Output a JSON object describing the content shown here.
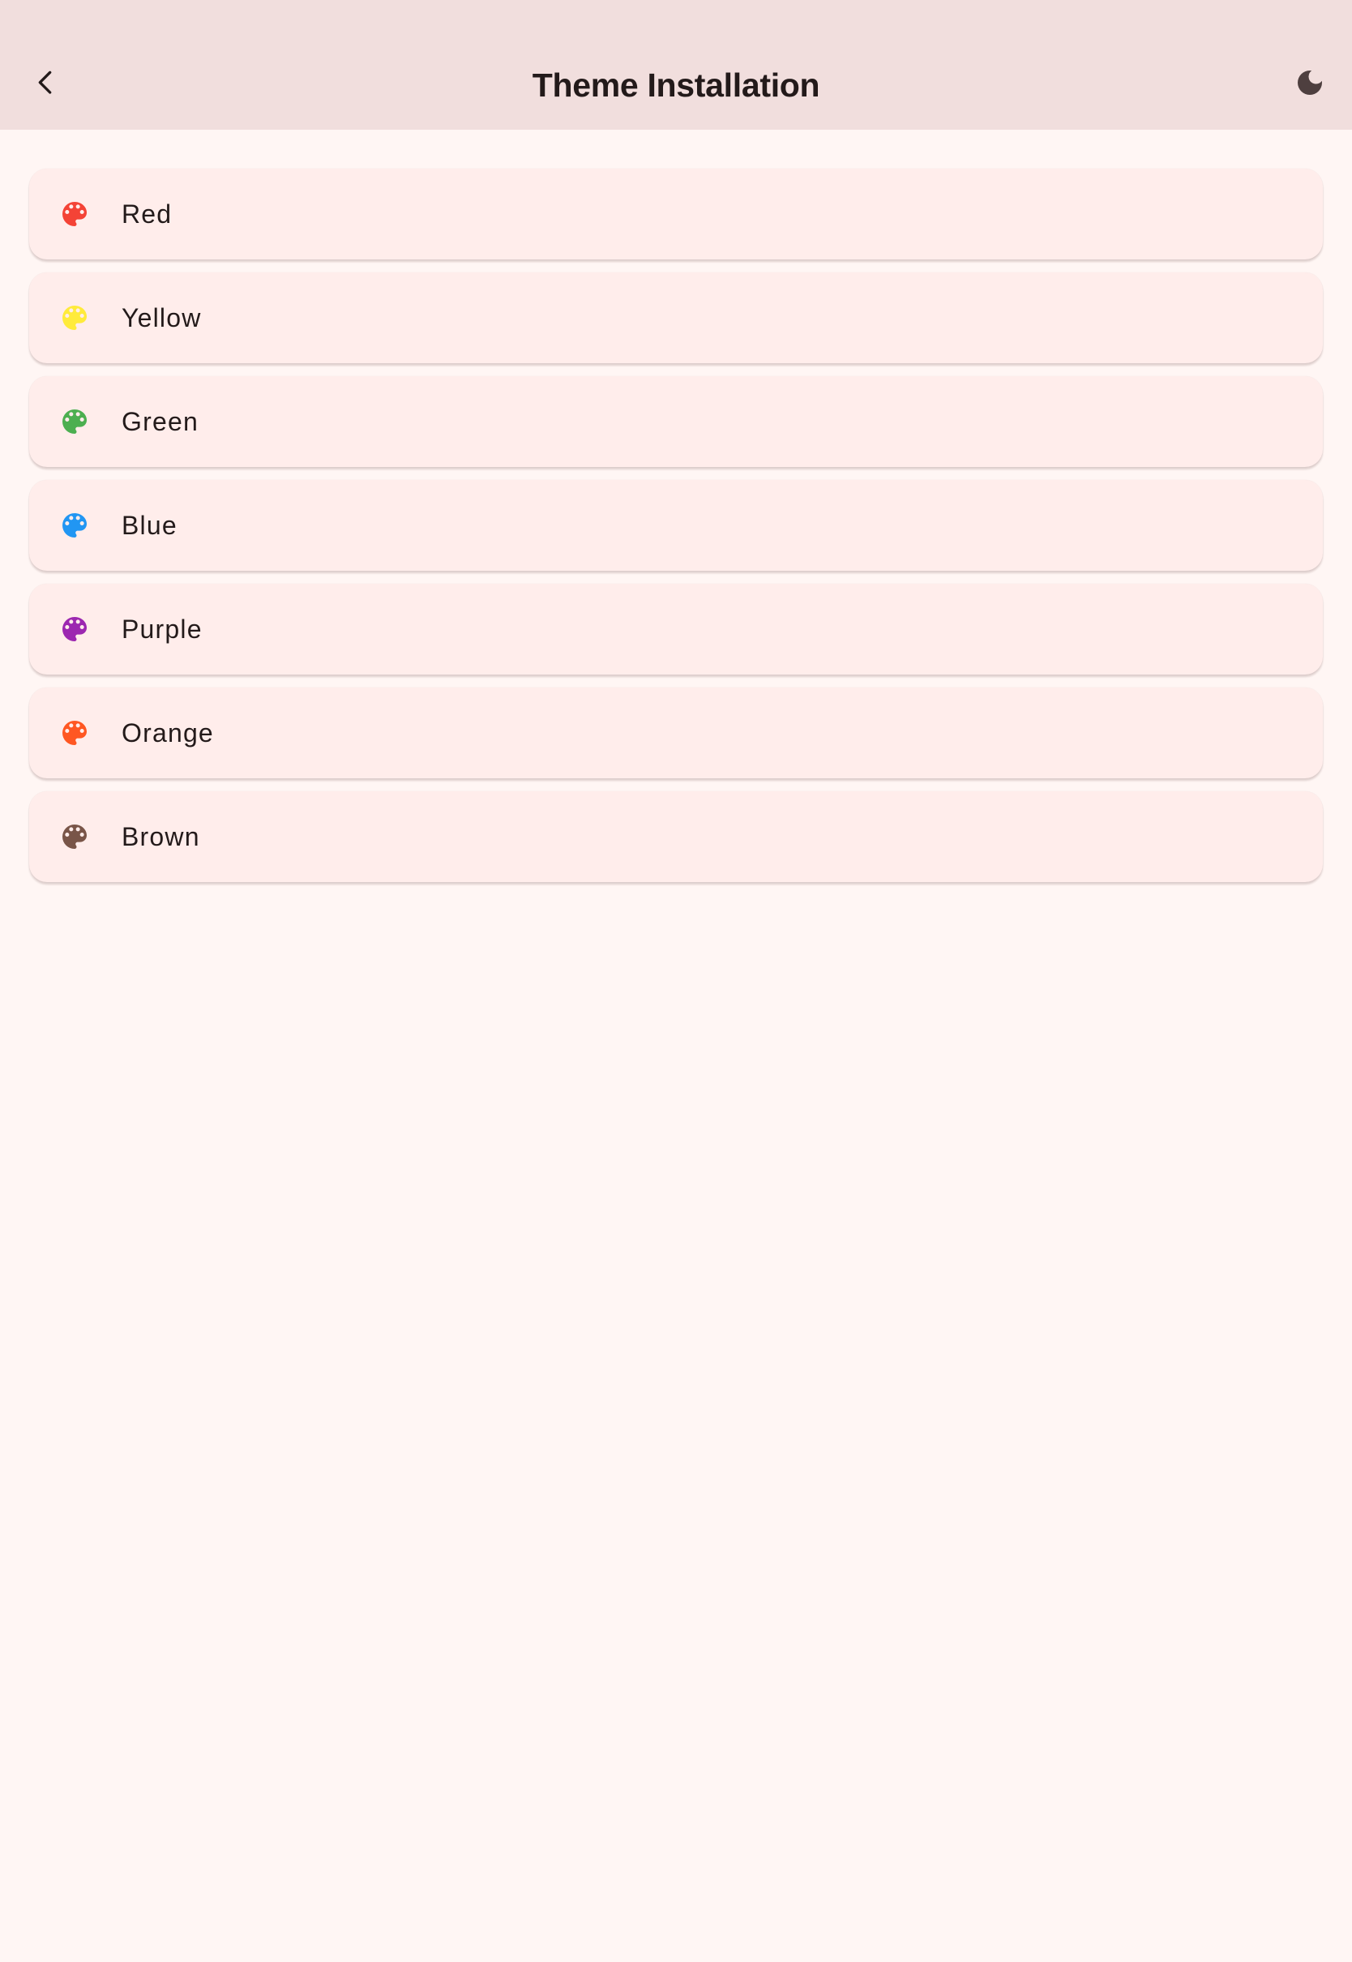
{
  "app_bar": {
    "title": "Theme Installation",
    "back_icon": "chevron-left-icon",
    "toggle_icon": "moon-icon",
    "background": "#F1DEDD"
  },
  "themes": [
    {
      "label": "Red",
      "icon": "palette-icon",
      "color": "#F44336"
    },
    {
      "label": "Yellow",
      "icon": "palette-icon",
      "color": "#FFEB3B"
    },
    {
      "label": "Green",
      "icon": "palette-icon",
      "color": "#4CAF50"
    },
    {
      "label": "Blue",
      "icon": "palette-icon",
      "color": "#2196F3"
    },
    {
      "label": "Purple",
      "icon": "palette-icon",
      "color": "#9C27B0"
    },
    {
      "label": "Orange",
      "icon": "palette-icon",
      "color": "#FF5722"
    },
    {
      "label": "Brown",
      "icon": "palette-icon",
      "color": "#795548"
    }
  ],
  "colors": {
    "page_background": "#FFF6F4",
    "card_background": "#FFEDEB",
    "text": "#231A1A",
    "icon_dark": "#4E3F3F"
  }
}
